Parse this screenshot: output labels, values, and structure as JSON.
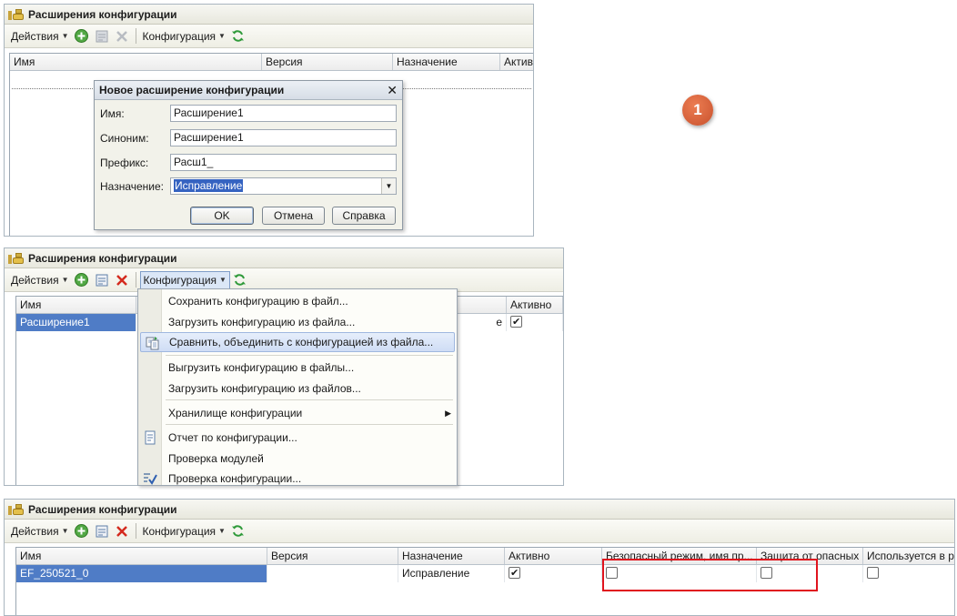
{
  "panel_title": "Расширения конфигурации",
  "toolbar": {
    "actions_label": "Действия",
    "config_label": "Конфигурация"
  },
  "grid_columns": {
    "name": "Имя",
    "version": "Версия",
    "purpose": "Назначение",
    "active": "Активно",
    "safe_mode": "Безопасный режим, имя пр...",
    "protection": "Защита от опасных ...",
    "used_in": "Используется в р"
  },
  "dialog": {
    "title": "Новое расширение конфигурации",
    "name_label": "Имя:",
    "name_value": "Расширение1",
    "synonym_label": "Синоним:",
    "synonym_value": "Расширение1",
    "prefix_label": "Префикс:",
    "prefix_value": "Расш1_",
    "purpose_label": "Назначение:",
    "purpose_value": "Исправление",
    "ok": "OK",
    "cancel": "Отмена",
    "help": "Справка"
  },
  "panel2": {
    "row_name": "Расширение1",
    "row_purpose_partial": "е",
    "row_active": true
  },
  "menu": {
    "items": [
      "Сохранить конфигурацию в файл...",
      "Загрузить конфигурацию из файла...",
      "Сравнить, объединить с конфигурацией из файла...",
      "Выгрузить конфигурацию в файлы...",
      "Загрузить конфигурацию из файлов...",
      "Хранилище конфигурации",
      "Отчет по конфигурации...",
      "Проверка модулей",
      "Проверка конфигурации..."
    ]
  },
  "panel3": {
    "row_name": "EF_250521_0",
    "row_version": "",
    "row_purpose": "Исправление",
    "row_active": true,
    "row_safe_mode": false,
    "row_protection": false,
    "row_used_in": false
  },
  "step_badge": "1",
  "colors": {
    "selection": "#4f7cc6",
    "highlight_box": "#e0141e",
    "badge": "#d35a34"
  }
}
